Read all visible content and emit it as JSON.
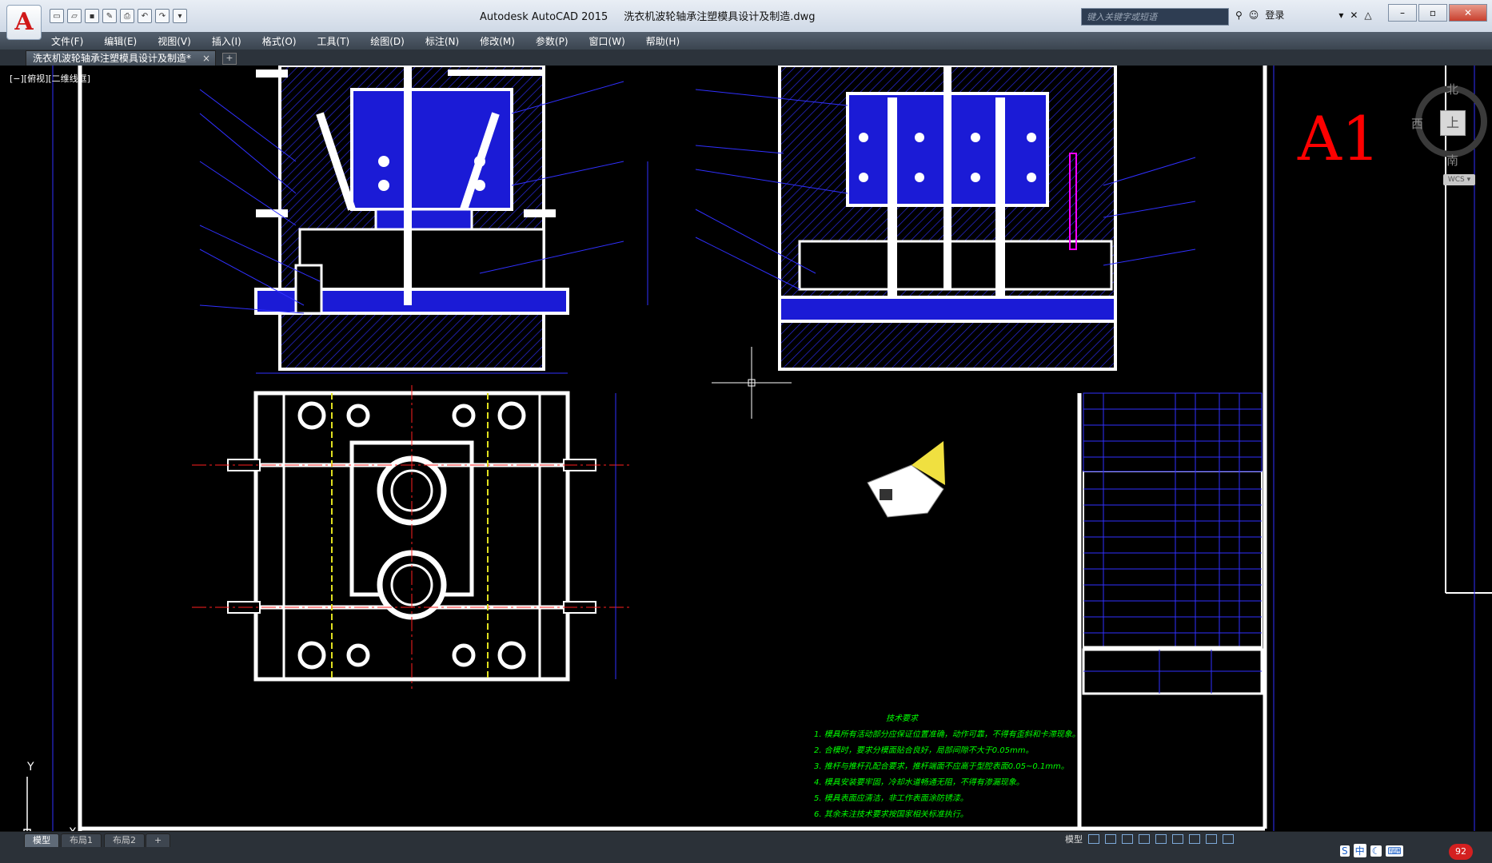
{
  "app": {
    "name": "Autodesk AutoCAD 2015",
    "file": "洗衣机波轮轴承注塑模具设计及制造.dwg",
    "logo_letter": "A"
  },
  "search": {
    "placeholder": "键入关键字或短语"
  },
  "user": {
    "login": "登录"
  },
  "menu": [
    "文件(F)",
    "编辑(E)",
    "视图(V)",
    "插入(I)",
    "格式(O)",
    "工具(T)",
    "绘图(D)",
    "标注(N)",
    "修改(M)",
    "参数(P)",
    "窗口(W)",
    "帮助(H)"
  ],
  "doc_tab": {
    "label": "洗衣机波轮轴承注塑模具设计及制造*",
    "close": "×",
    "add": "+"
  },
  "viewport": {
    "label": "[−][俯视][二维线框]"
  },
  "sheet": {
    "size_label": "A1"
  },
  "viewcube": {
    "north": "北",
    "west": "西",
    "south": "南",
    "face": "上",
    "wcs": "WCS ▾"
  },
  "tech_requirements": {
    "title": "技术要求",
    "items": [
      "1. 模具所有活动部分应保证位置准确，动作可靠，不得有歪斜和卡滞现象。",
      "2. 合模时，要求分模面贴合良好，局部间隙不大于0.05mm。",
      "3. 推杆与推杆孔配合要求，推杆端面不应高于型腔表面0.05~0.1mm。",
      "4. 模具安装要牢固，冷却水道畅通无阻，不得有渗漏现象。",
      "5. 模具表面应清洁，非工作表面涂防锈漆。",
      "6. 其余未注技术要求按国家相关标准执行。"
    ]
  },
  "ucs": {
    "x": "X",
    "y": "Y"
  },
  "layout_tabs": [
    "模型",
    "布局1",
    "布局2",
    "+"
  ],
  "status": {
    "model": "模型",
    "ime_lang": "中",
    "badge": "92"
  },
  "colors": {
    "accent_red": "#d01818",
    "sheet_red": "#ff0000",
    "text_green": "#00ff00",
    "hatch_blue": "#1b1bd6",
    "line_white": "#ffffff"
  }
}
